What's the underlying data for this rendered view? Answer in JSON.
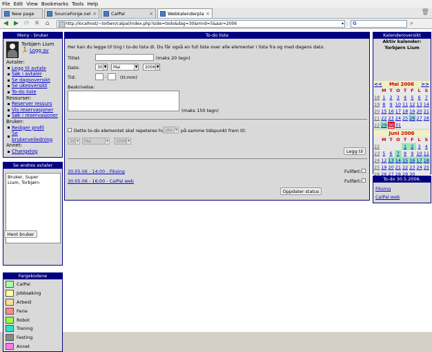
{
  "browser": {
    "menu": [
      "File",
      "Edit",
      "View",
      "Bookmarks",
      "Tools",
      "Help"
    ],
    "tabs": [
      {
        "label": "New page",
        "active": false
      },
      {
        "label": "SourceForge.net: Cal...",
        "active": false
      },
      {
        "label": "CalPal",
        "active": false
      },
      {
        "label": "Webkalenderplanleg...",
        "active": true
      }
    ],
    "url": "http://localhost/~torben/calpal/index.php?side=todo&dag=30&mnd=5&aar=2006",
    "search_logo": "G"
  },
  "menu_panel": {
    "title": "Meny - bruker",
    "user_name": "Torbjørn Lium",
    "logout": "Logg av",
    "sections": [
      {
        "heading": "Avtaler:",
        "items": [
          "Legg til avtale",
          "Søk i avtaler",
          "Se dagsoversikt",
          "Se ukeoversikt",
          "To-do liste"
        ]
      },
      {
        "heading": "Ressurser:",
        "items": [
          "Reserver ressurs",
          "Vis reservasjoner",
          "Søk i reservasjoner"
        ]
      },
      {
        "heading": "Bruker:",
        "items": [
          "Rediger profil",
          "Se brukerveiledning"
        ]
      },
      {
        "heading": "Annet:",
        "items": [
          "Changelog"
        ]
      }
    ]
  },
  "others_panel": {
    "title": "Se andres avtaler",
    "users": [
      "Bruker, Super",
      "Lium, Torbjørn"
    ],
    "button": "Hent bruker"
  },
  "colors_panel": {
    "title": "Fargekodene",
    "items": [
      {
        "label": "CalPal",
        "color": "#aaffaa"
      },
      {
        "label": "Jobbsøking",
        "color": "#ffffaa"
      },
      {
        "label": "Arbeid",
        "color": "#ffdd99"
      },
      {
        "label": "Ferie",
        "color": "#ff8888"
      },
      {
        "label": "Robot",
        "color": "#99ff44"
      },
      {
        "label": "Trening",
        "color": "#33ddcc"
      },
      {
        "label": "Festing",
        "color": "#888888"
      },
      {
        "label": "Annet",
        "color": "#ff77ee"
      }
    ]
  },
  "todo": {
    "title": "To-do liste",
    "intro": "Her kan du legge til ting i to-do lista di. Du får også en full liste over alle elementer i lista fra og med dagens dato.",
    "title_label": "Tittel:",
    "title_value": "",
    "title_note": "(maks 20 tegn)",
    "date_label": "Dato:",
    "date_day": "30",
    "date_month": "Mai",
    "date_year": "2006",
    "time_label": "Tid:",
    "time_hour": "",
    "time_minute": "",
    "time_note": "(tt:mm)",
    "desc_label": "Beskrivelse:",
    "desc_note": "(maks 150 tegn)",
    "repeat_text_1": "Dette to-do elementet skal repeteres hver",
    "repeat_unit": "uke",
    "repeat_text_2": "på samme tidspunkt frem til:",
    "repeat_day": "30",
    "repeat_month": "Mai",
    "repeat_year": "2006",
    "add_button": "Legg til",
    "entries": [
      {
        "text": "30.05.06 - 14:00 - Fiksing",
        "done_label": "Fullført:",
        "done": false
      },
      {
        "text": "30.05.06 - 16:00 - CalPal web",
        "done_label": "Fullført:",
        "done": false
      }
    ],
    "update_button": "Oppdater status"
  },
  "calendar": {
    "title": "Kalenderoversikt",
    "active_label": "Aktiv kalender:",
    "active_user": "Torbjørn Lium",
    "prev": "<<",
    "next": ">>",
    "months": [
      {
        "name": "Mai 2006",
        "day_headers": [
          "M",
          "T",
          "O",
          "T",
          "F",
          "L",
          "S"
        ],
        "weeks": [
          {
            "week": "18",
            "days": [
              "1",
              "2",
              "3",
              "4",
              "5",
              "6",
              "7"
            ]
          },
          {
            "week": "19",
            "days": [
              "8",
              "9",
              "10",
              "11",
              "12",
              "13",
              "14"
            ]
          },
          {
            "week": "20",
            "days": [
              "15",
              "16",
              "17",
              "18",
              "19",
              "20",
              "21"
            ]
          },
          {
            "week": "21",
            "days": [
              "22",
              "23",
              "24",
              "25",
              "26",
              "27",
              "28"
            ]
          },
          {
            "week": "22",
            "days": [
              "29",
              "30",
              "31",
              "",
              "",
              "",
              ""
            ]
          }
        ],
        "highlighted": [
          "26",
          "29"
        ],
        "today": "30"
      },
      {
        "name": "Juni 2006",
        "day_headers": [
          "M",
          "T",
          "O",
          "T",
          "F",
          "L",
          "S"
        ],
        "weeks": [
          {
            "week": "22",
            "days": [
              "",
              "",
              "",
              "1",
              "2",
              "3",
              "4"
            ]
          },
          {
            "week": "23",
            "days": [
              "5",
              "6",
              "7",
              "8",
              "9",
              "10",
              "11"
            ]
          },
          {
            "week": "24",
            "days": [
              "12",
              "13",
              "14",
              "15",
              "16",
              "17",
              "18"
            ]
          },
          {
            "week": "25",
            "days": [
              "19",
              "20",
              "21",
              "22",
              "23",
              "24",
              "25"
            ]
          },
          {
            "week": "26",
            "days": [
              "26",
              "27",
              "28",
              "29",
              "30",
              "",
              ""
            ]
          }
        ],
        "highlighted": [
          "1",
          "2",
          "7",
          "13",
          "14",
          "15",
          "16",
          "17",
          "18"
        ],
        "today": ""
      }
    ]
  },
  "todo_date": {
    "title": "To-do 30.5.2006.",
    "items": [
      "Fiksing",
      "CalPal web"
    ]
  }
}
